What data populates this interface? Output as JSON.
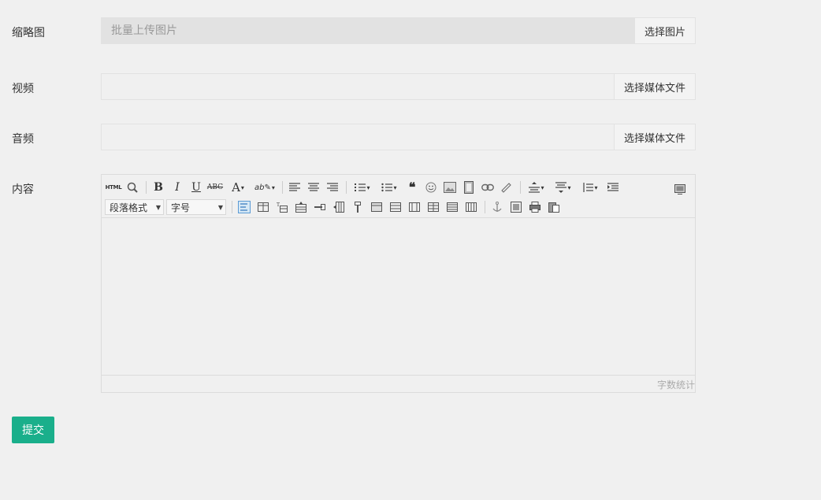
{
  "thumbnail": {
    "label": "缩略图",
    "placeholder": "批量上传图片",
    "button": "选择图片"
  },
  "video": {
    "label": "视频",
    "value": "",
    "button": "选择媒体文件"
  },
  "audio": {
    "label": "音频",
    "value": "",
    "button": "选择媒体文件"
  },
  "content": {
    "label": "内容",
    "toolbar": {
      "html_label": "HTML",
      "paragraph_select": "段落格式",
      "fontsize_select": "字号"
    },
    "word_count_label": "字数统计"
  },
  "submit_label": "提交",
  "colors": {
    "accent": "#1aaf8b",
    "background": "#f0f0f0",
    "border": "#e2e2e2"
  }
}
